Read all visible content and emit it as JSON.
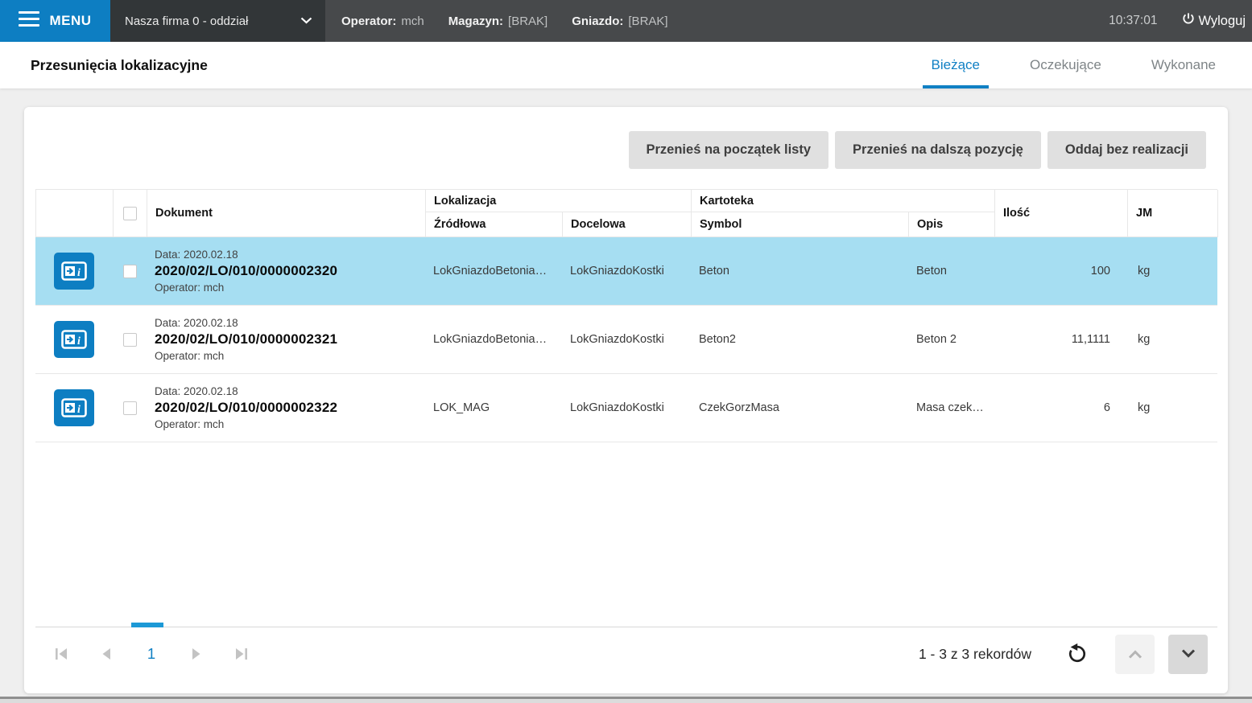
{
  "topbar": {
    "menu_label": "MENU",
    "company": "Nasza firma 0 - oddział",
    "operator_label": "Operator:",
    "operator_value": "mch",
    "warehouse_label": "Magazyn:",
    "warehouse_value": "[BRAK]",
    "slot_label": "Gniazdo:",
    "slot_value": "[BRAK]",
    "clock": "10:37:01",
    "logout_label": "Wyloguj"
  },
  "page": {
    "title": "Przesunięcia lokalizacyjne"
  },
  "tabs": {
    "current": "Bieżące",
    "pending": "Oczekujące",
    "done": "Wykonane"
  },
  "actions": {
    "move_to_top": "Przenieś na początek listy",
    "move_to_next": "Przenieś na dalszą pozycję",
    "return_without": "Oddaj bez realizacji"
  },
  "table": {
    "group_lokalizacja": "Lokalizacja",
    "group_kartoteka": "Kartoteka",
    "col_dokument": "Dokument",
    "col_zrodlowa": "Źródłowa",
    "col_docelowa": "Docelowa",
    "col_symbol": "Symbol",
    "col_opis": "Opis",
    "col_ilosc": "Ilość",
    "col_jm": "JM",
    "rows": [
      {
        "date": "Data: 2020.02.18",
        "document": "2020/02/LO/010/0000002320",
        "operator": "Operator: mch",
        "zrodlowa": "LokGniazdoBetonia…",
        "docelowa": "LokGniazdoKostki",
        "symbol": "Beton",
        "opis": "Beton",
        "ilosc": "100",
        "jm": "kg"
      },
      {
        "date": "Data: 2020.02.18",
        "document": "2020/02/LO/010/0000002321",
        "operator": "Operator: mch",
        "zrodlowa": "LokGniazdoBetonia…",
        "docelowa": "LokGniazdoKostki",
        "symbol": "Beton2",
        "opis": "Beton 2",
        "ilosc": "11,1111",
        "jm": "kg"
      },
      {
        "date": "Data: 2020.02.18",
        "document": "2020/02/LO/010/0000002322",
        "operator": "Operator: mch",
        "zrodlowa": "LOK_MAG",
        "docelowa": "LokGniazdoKostki",
        "symbol": "CzekGorzMasa",
        "opis": "Masa czek…",
        "ilosc": "6",
        "jm": "kg"
      }
    ]
  },
  "pagination": {
    "page": "1",
    "records": "1 - 3 z 3 rekordów"
  },
  "colors": {
    "accent_blue": "#0d7ec2",
    "tab_blue": "#1080c4",
    "selected_row": "#a6def2",
    "pagination_indicator": "#1c99d6",
    "topbar_dark": "#47494b"
  }
}
